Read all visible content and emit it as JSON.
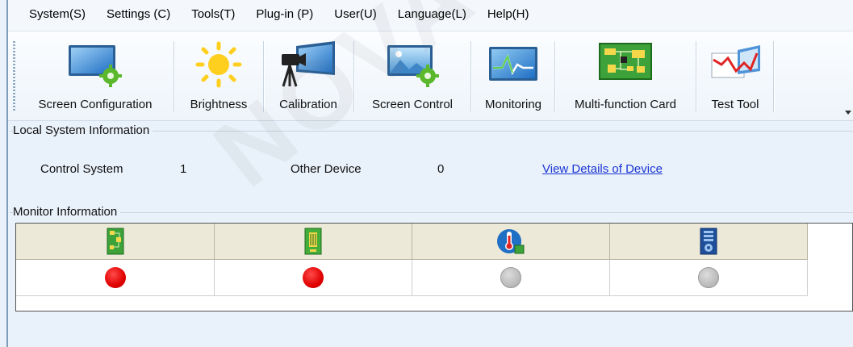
{
  "menu": {
    "items": [
      "System(S)",
      "Settings (C)",
      "Tools(T)",
      "Plug-in (P)",
      "User(U)",
      "Language(L)",
      "Help(H)"
    ]
  },
  "toolbar": {
    "buttons": [
      {
        "label": "Screen Configuration",
        "icon": "screen-config-icon"
      },
      {
        "label": "Brightness",
        "icon": "sun-icon"
      },
      {
        "label": "Calibration",
        "icon": "camera-icon"
      },
      {
        "label": "Screen Control",
        "icon": "screen-control-icon"
      },
      {
        "label": "Monitoring",
        "icon": "monitor-wave-icon"
      },
      {
        "label": "Multi-function Card",
        "icon": "circuit-board-icon"
      },
      {
        "label": "Test Tool",
        "icon": "chart-test-icon"
      }
    ]
  },
  "local_system": {
    "title": "Local System Information",
    "control_system_label": "Control System",
    "control_system_value": "1",
    "other_device_label": "Other Device",
    "other_device_value": "0",
    "view_details_link": "View Details of Device"
  },
  "monitor": {
    "title": "Monitor Information",
    "columns": [
      {
        "icon": "receiving-card-icon",
        "status": "error",
        "status_color": "#e00000"
      },
      {
        "icon": "sending-card-icon",
        "status": "error",
        "status_color": "#e00000"
      },
      {
        "icon": "temperature-icon",
        "status": "unknown",
        "status_color": "#bdbdbd"
      },
      {
        "icon": "power-module-icon",
        "status": "unknown",
        "status_color": "#bdbdbd"
      }
    ]
  },
  "watermark": "NOVASTAR TECH"
}
